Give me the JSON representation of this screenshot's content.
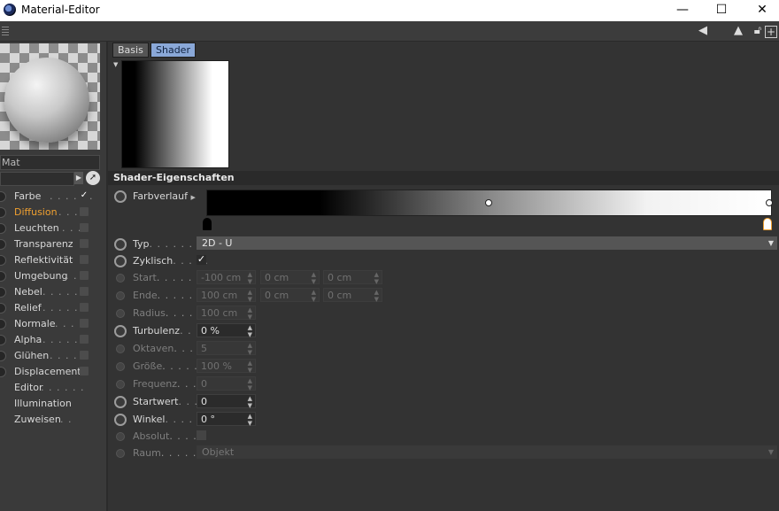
{
  "window": {
    "title": "Material-Editor",
    "controls": [
      "—",
      "☐",
      "✕"
    ]
  },
  "toolbar": {
    "icons": [
      "arrow-left-icon",
      "pointer-up-icon",
      "lock-icon",
      "add-panel-icon"
    ]
  },
  "material": {
    "name": "Mat"
  },
  "channels": [
    {
      "label": "Farbe",
      "dots": ". . . . . .",
      "checked": true
    },
    {
      "label": "Diffusion",
      "dots": ". . .",
      "checked": false,
      "active": true
    },
    {
      "label": "Leuchten",
      "dots": ". . . .",
      "checked": false
    },
    {
      "label": "Transparenz",
      "dots": "",
      "checked": false
    },
    {
      "label": "Reflektivität",
      "dots": "",
      "checked": false
    },
    {
      "label": "Umgebung",
      "dots": ". .",
      "checked": false
    },
    {
      "label": "Nebel",
      "dots": ". . . . . .",
      "checked": false
    },
    {
      "label": "Relief",
      "dots": ". . . . .",
      "checked": false
    },
    {
      "label": "Normale",
      "dots": ". . . .",
      "checked": false
    },
    {
      "label": "Alpha",
      "dots": ". . . . . .",
      "checked": false
    },
    {
      "label": "Glühen",
      "dots": ". . . . .",
      "checked": false
    },
    {
      "label": "Displacement",
      "dots": "",
      "checked": false
    },
    {
      "label": "Editor",
      "dots": ". . . . . ."
    },
    {
      "label": "Illumination",
      "dots": ""
    },
    {
      "label": "Zuweisen",
      "dots": ". ."
    }
  ],
  "tabs": {
    "basis": "Basis",
    "shader": "Shader"
  },
  "section_title": "Shader-Eigenschaften",
  "props": {
    "farbverlauf": {
      "label": "Farbverlauf"
    },
    "typ": {
      "label": "Typ",
      "dots": ". . . . . . . . .",
      "value": "2D - U"
    },
    "zyklisch": {
      "label": "Zyklisch",
      "dots": ". . . . .",
      "checked": true
    },
    "start": {
      "label": "Start",
      "dots": ". . . . . . . .",
      "v1": "-100 cm",
      "v2": "0 cm",
      "v3": "0 cm"
    },
    "ende": {
      "label": "Ende",
      "dots": ". . . . . . . .",
      "v1": "100 cm",
      "v2": "0 cm",
      "v3": "0 cm"
    },
    "radius": {
      "label": "Radius",
      "dots": ". . . . . .",
      "value": "100 cm"
    },
    "turbulenz": {
      "label": "Turbulenz",
      "dots": ". . .",
      "value": "0 %"
    },
    "oktaven": {
      "label": "Oktaven",
      "dots": ". . . . .",
      "value": "5"
    },
    "groesse": {
      "label": "Größe",
      "dots": ". . . . . . .",
      "value": "100 %"
    },
    "frequenz": {
      "label": "Frequenz",
      "dots": ". . . .",
      "value": "0"
    },
    "startwert": {
      "label": "Startwert",
      "dots": ". . . .",
      "value": "0"
    },
    "winkel": {
      "label": "Winkel",
      "dots": ". . . . . .",
      "value": "0 °"
    },
    "absolut": {
      "label": "Absolut",
      "dots": ". . . . .",
      "checked": false
    },
    "raum": {
      "label": "Raum",
      "dots": ". . . . . . . .",
      "value": "Objekt"
    }
  },
  "gradient": {
    "knots": [
      0.5,
      1.0
    ],
    "stops": [
      {
        "position": 0.0,
        "color": "#000000"
      },
      {
        "position": 1.0,
        "color": "#ffffff"
      }
    ]
  },
  "colors": {
    "accent": "#f0a030",
    "tab_active": "#8aa8d8",
    "panel": "#333333"
  }
}
